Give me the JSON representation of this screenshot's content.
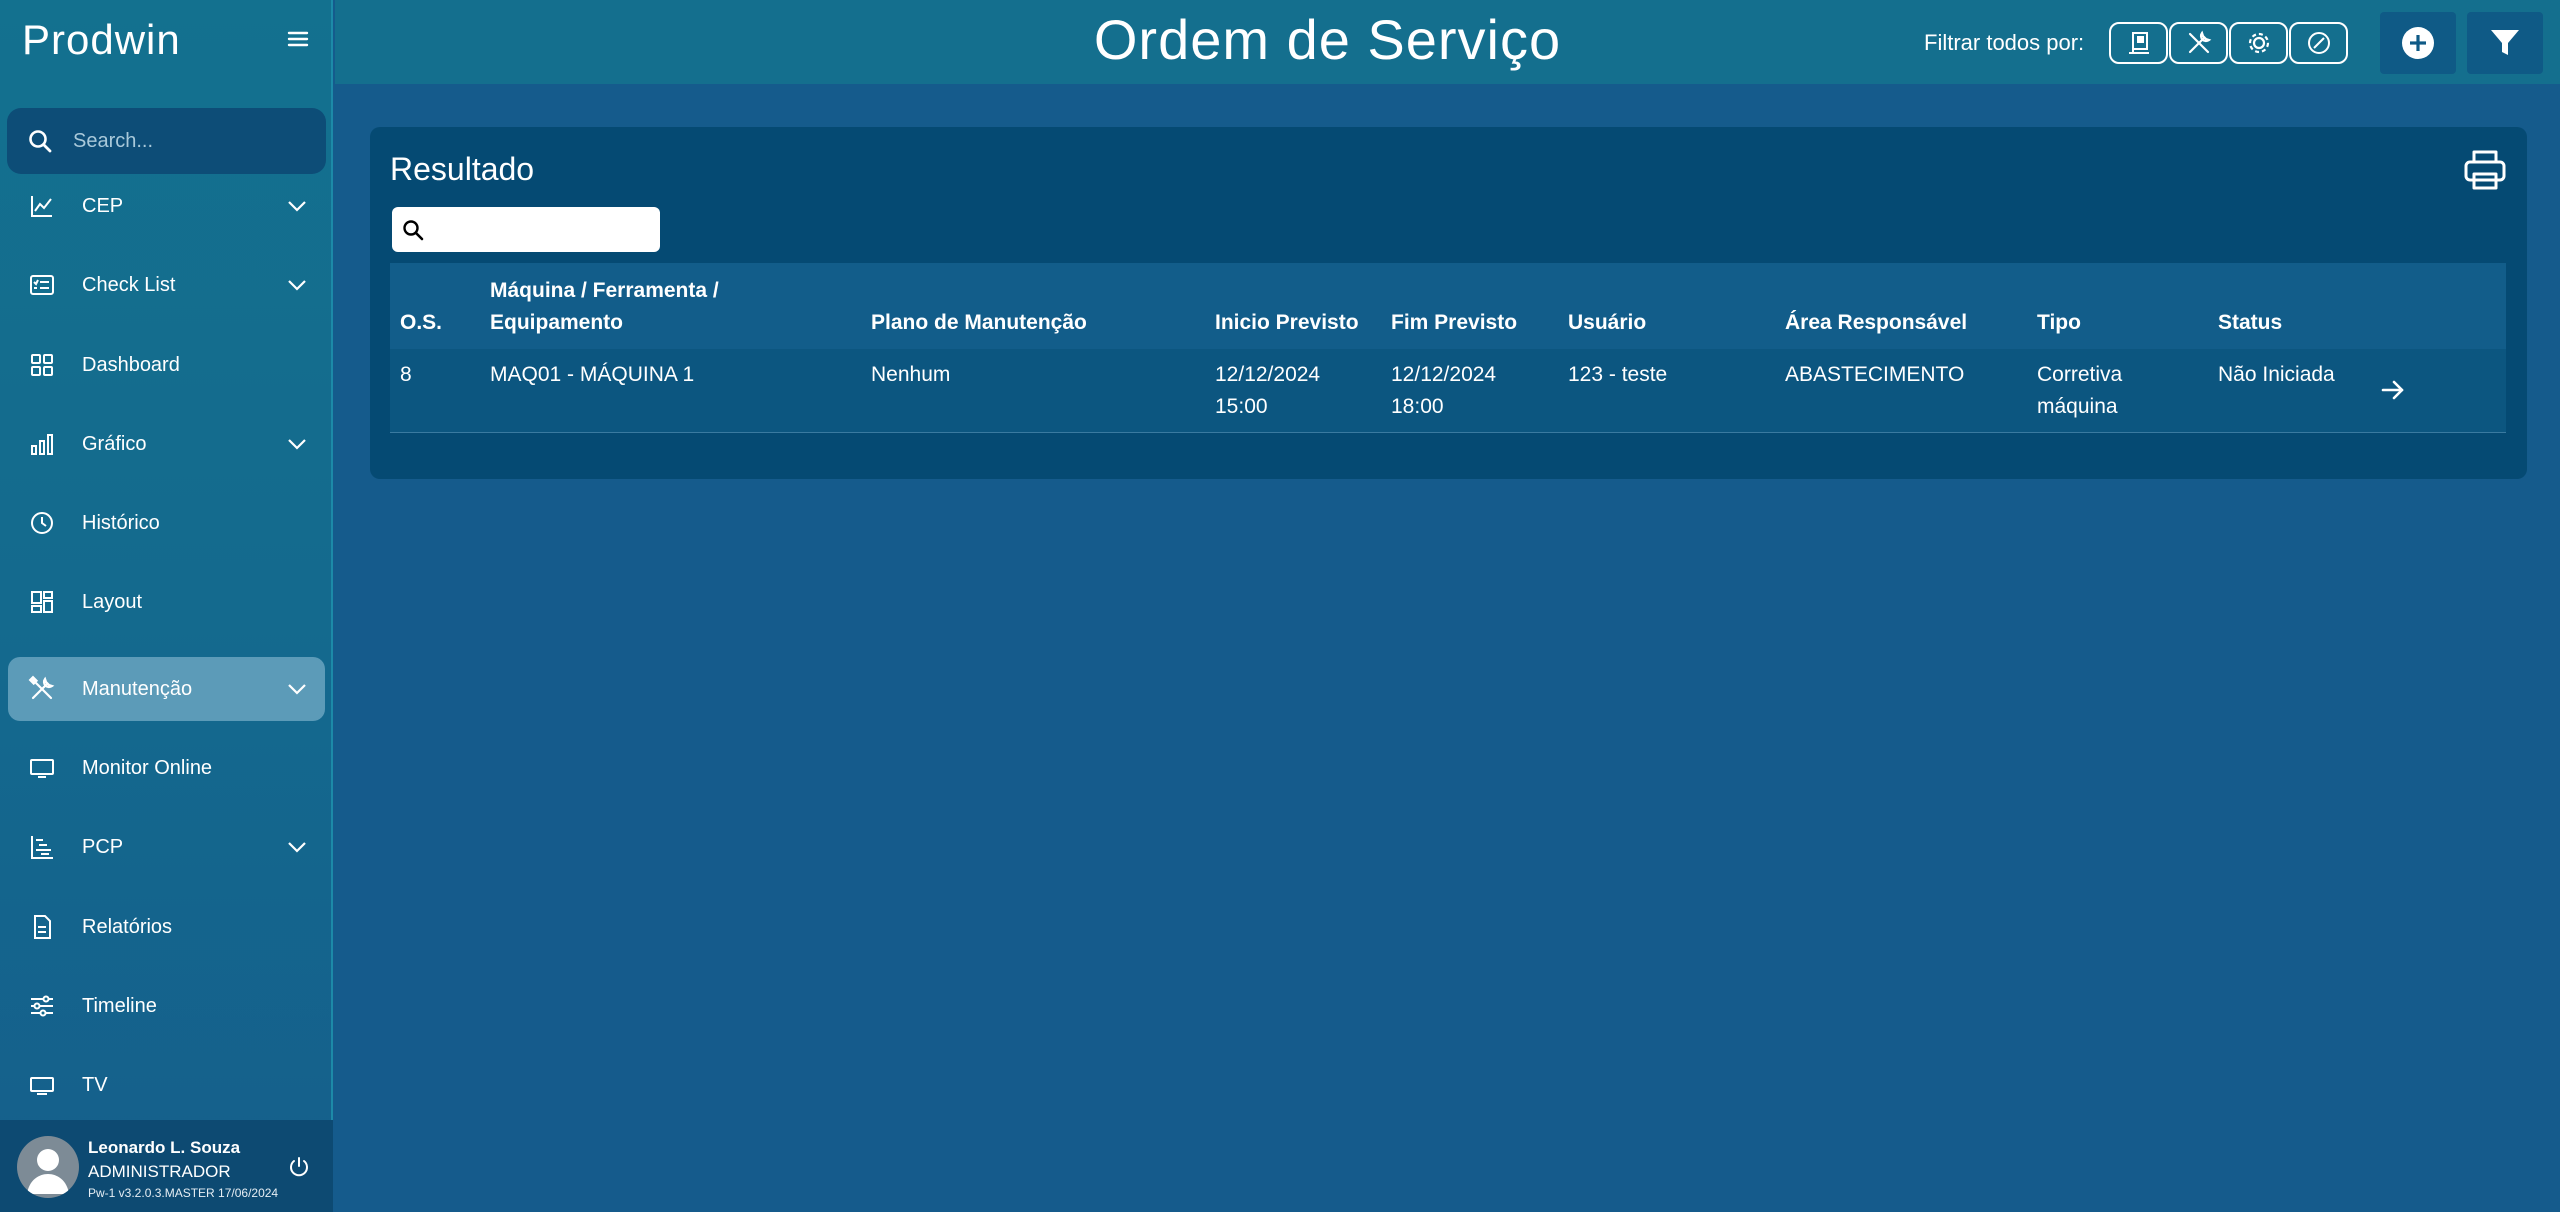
{
  "app": {
    "brand": "Prodwin"
  },
  "sidebar": {
    "search_placeholder": "Search...",
    "items": [
      {
        "label": "CEP",
        "icon": "line-chart-icon",
        "expandable": true
      },
      {
        "label": "Check List",
        "icon": "checklist-icon",
        "expandable": true
      },
      {
        "label": "Dashboard",
        "icon": "dashboard-grid-icon",
        "expandable": false
      },
      {
        "label": "Gráfico",
        "icon": "bar-chart-icon",
        "expandable": true
      },
      {
        "label": "Histórico",
        "icon": "clock-icon",
        "expandable": false
      },
      {
        "label": "Layout",
        "icon": "layout-icon",
        "expandable": false
      },
      {
        "label": "Manutenção",
        "icon": "tools-icon",
        "expandable": true,
        "active": true
      },
      {
        "label": "Monitor Online",
        "icon": "monitor-icon",
        "expandable": false
      },
      {
        "label": "PCP",
        "icon": "gantt-icon",
        "expandable": true
      },
      {
        "label": "Relatórios",
        "icon": "document-icon",
        "expandable": false
      },
      {
        "label": "Timeline",
        "icon": "sliders-icon",
        "expandable": false
      },
      {
        "label": "TV",
        "icon": "tv-icon",
        "expandable": false
      }
    ],
    "user": {
      "name": "Leonardo L. Souza",
      "role": "ADMINISTRADOR",
      "version": "Pw-1 v3.2.0.3.MASTER 17/06/2024"
    }
  },
  "header": {
    "title": "Ordem de Serviço",
    "filter_label": "Filtrar todos por:"
  },
  "result": {
    "title": "Resultado",
    "search_value": "",
    "columns": {
      "os": "O.S.",
      "machine_line1": "Máquina / Ferramenta /",
      "machine_line2": "Equipamento",
      "plan": "Plano de Manutenção",
      "start": "Inicio Previsto",
      "end": "Fim Previsto",
      "user": "Usuário",
      "area": "Área Responsável",
      "type": "Tipo",
      "status": "Status"
    },
    "rows": [
      {
        "os": "8",
        "machine": "MAQ01 - MÁQUINA 1",
        "plan": "Nenhum",
        "start_date": "12/12/2024",
        "start_time": "15:00",
        "end_date": "12/12/2024",
        "end_time": "18:00",
        "user": "123 - teste",
        "area": "ABASTECIMENTO",
        "type_line1": "Corretiva",
        "type_line2": "máquina",
        "status": "Não Iniciada"
      }
    ]
  },
  "colors": {
    "sidebar_bg": "#13718f",
    "content_bg": "#155b8c",
    "card_bg": "#054a73",
    "active_item": "#5c9bb8"
  }
}
